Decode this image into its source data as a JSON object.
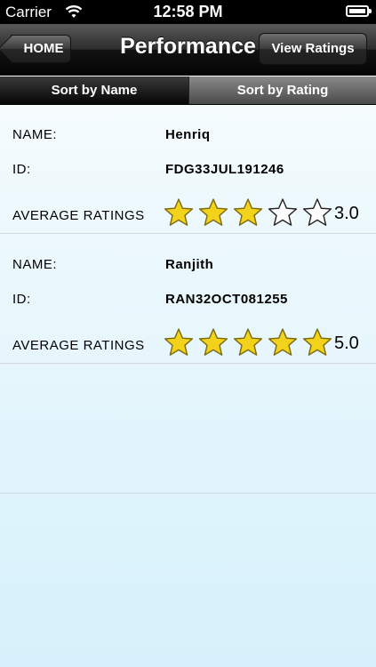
{
  "status_bar": {
    "carrier": "Carrier",
    "time": "12:58 PM"
  },
  "nav": {
    "back_label": "HOME",
    "title": "Performance",
    "right_label": "View Ratings"
  },
  "segments": [
    {
      "label": "Sort by Name",
      "selected": true
    },
    {
      "label": "Sort by Rating",
      "selected": false
    }
  ],
  "records": [
    {
      "name_label": "NAME:",
      "name": "Henriq",
      "id_label": "ID:",
      "id": "FDG33JUL191246",
      "rating_label": "AVERAGE RATINGS",
      "rating_text": "3.0",
      "rating": 3
    },
    {
      "name_label": "NAME:",
      "name": "Ranjith",
      "id_label": "ID:",
      "id": "RAN32OCT081255",
      "rating_label": "AVERAGE RATINGS",
      "rating_text": "5.0",
      "rating": 5
    }
  ],
  "colors": {
    "star_fill": "#f2d21a",
    "star_stroke": "#7a6a10"
  }
}
